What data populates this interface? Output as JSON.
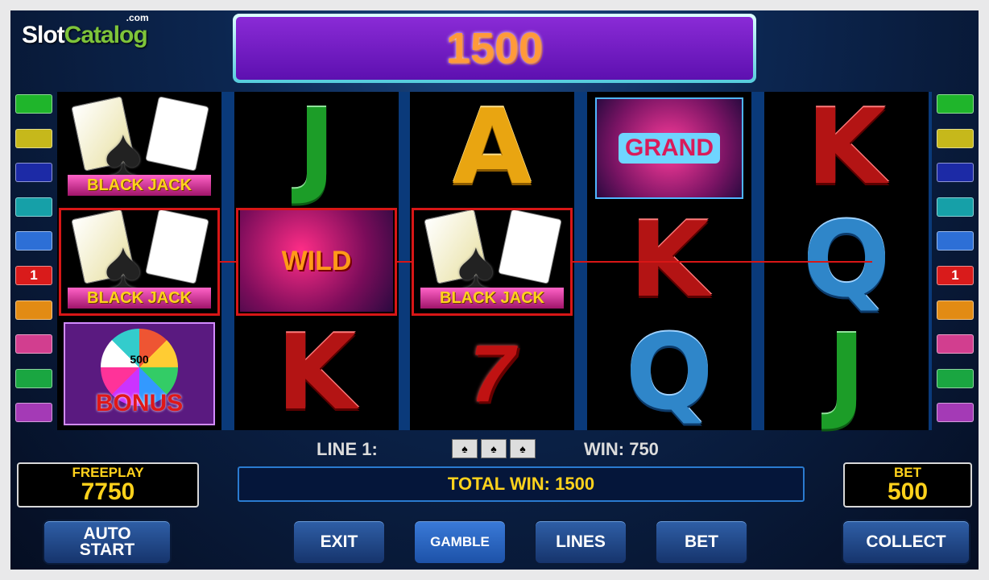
{
  "logo": {
    "main_white": "Slot",
    "main_green": "Catalog",
    "suffix": ".com"
  },
  "top_win": "1500",
  "paylines_left": [
    {
      "label": "",
      "color": "#1fb52b"
    },
    {
      "label": "",
      "color": "#c6b81b"
    },
    {
      "label": "",
      "color": "#1c2aa6"
    },
    {
      "label": "",
      "color": "#16a0a8"
    },
    {
      "label": "",
      "color": "#2d6fd6"
    },
    {
      "label": "1",
      "color": "#d91b1b",
      "active": true
    },
    {
      "label": "",
      "color": "#e28b14"
    },
    {
      "label": "",
      "color": "#d23e8f"
    },
    {
      "label": "",
      "color": "#1aa641"
    },
    {
      "label": "",
      "color": "#a43ab6"
    }
  ],
  "paylines_right": [
    {
      "label": "",
      "color": "#1fb52b"
    },
    {
      "label": "",
      "color": "#c6b81b"
    },
    {
      "label": "",
      "color": "#1c2aa6"
    },
    {
      "label": "",
      "color": "#16a0a8"
    },
    {
      "label": "",
      "color": "#2d6fd6"
    },
    {
      "label": "1",
      "color": "#d91b1b",
      "active": true
    },
    {
      "label": "",
      "color": "#e28b14"
    },
    {
      "label": "",
      "color": "#d23e8f"
    },
    {
      "label": "",
      "color": "#1aa641"
    },
    {
      "label": "",
      "color": "#a43ab6"
    }
  ],
  "reels": [
    [
      {
        "type": "blackjack",
        "text": "BLACK JACK"
      },
      {
        "type": "blackjack",
        "text": "BLACK JACK",
        "win": true
      },
      {
        "type": "bonus",
        "text": "BONUS",
        "wheel_label": "500"
      }
    ],
    [
      {
        "type": "letter",
        "text": "J"
      },
      {
        "type": "wild",
        "text": "WILD",
        "win": true
      },
      {
        "type": "letter",
        "text": "K"
      }
    ],
    [
      {
        "type": "letter",
        "text": "A"
      },
      {
        "type": "blackjack",
        "text": "BLACK JACK",
        "win": true
      },
      {
        "type": "seven",
        "text": "7"
      }
    ],
    [
      {
        "type": "grand",
        "text": "GRAND"
      },
      {
        "type": "letter",
        "text": "K"
      },
      {
        "type": "letter",
        "text": "Q"
      }
    ],
    [
      {
        "type": "letter",
        "text": "K"
      },
      {
        "type": "letter",
        "text": "Q"
      },
      {
        "type": "letter",
        "text": "J"
      }
    ]
  ],
  "line_info": {
    "label": "LINE 1:",
    "win": "WIN: 750"
  },
  "freeplay": {
    "label": "FREEPLAY",
    "value": "7750"
  },
  "total_win": "TOTAL WIN: 1500",
  "bet": {
    "label": "BET",
    "value": "500"
  },
  "buttons": {
    "auto_start": "AUTO\nSTART",
    "exit": "EXIT",
    "gamble": "GAMBLE",
    "lines": "LINES",
    "bet": "BET",
    "collect": "COLLECT"
  }
}
